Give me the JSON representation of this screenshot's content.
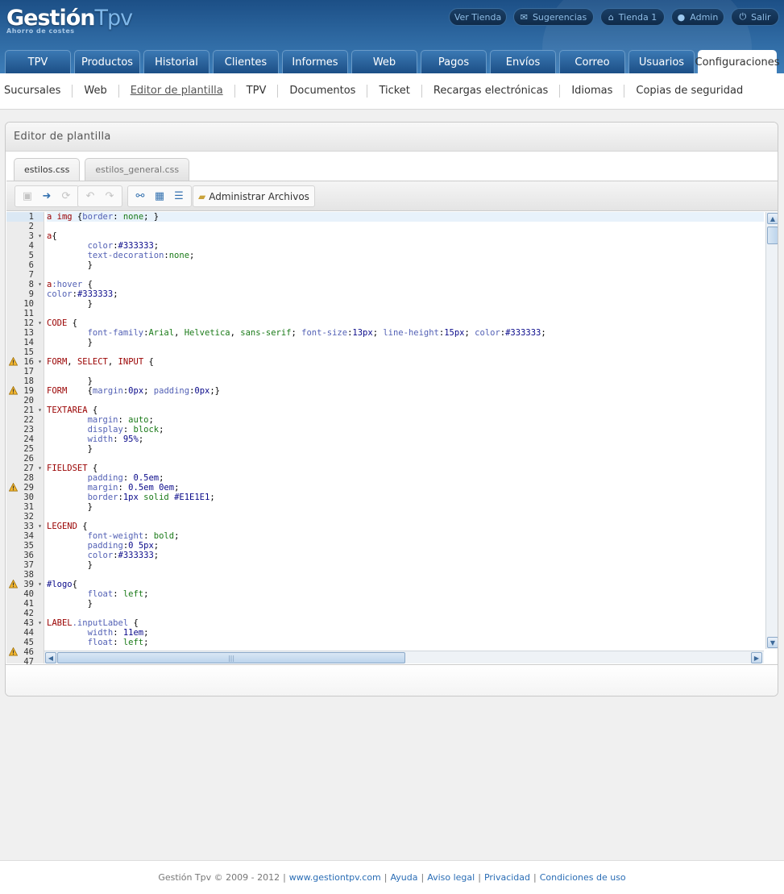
{
  "brand": {
    "name_a": "Gestión",
    "name_b": "Tpv",
    "tagline": "Ahorro de costes"
  },
  "top_links": [
    {
      "label": "Ver Tienda",
      "icon": "none"
    },
    {
      "label": "Sugerencias",
      "icon": "envelope-icon"
    },
    {
      "label": "Tienda 1",
      "icon": "home-icon"
    },
    {
      "label": "Admin",
      "icon": "user-icon"
    },
    {
      "label": "Salir",
      "icon": "power-icon"
    }
  ],
  "main_tabs": [
    "TPV",
    "Productos",
    "Historial",
    "Clientes",
    "Informes",
    "Web",
    "Pagos",
    "Envíos",
    "Correo",
    "Usuarios",
    "Configuraciones"
  ],
  "active_main_tab": "Configuraciones",
  "sub_nav": [
    "Sucursales",
    "Web",
    "Editor de plantilla",
    "TPV",
    "Documentos",
    "Ticket",
    "Recargas electrónicas",
    "Idiomas",
    "Copias de seguridad"
  ],
  "active_sub_nav": "Editor de plantilla",
  "panel": {
    "title": "Editor de plantilla"
  },
  "file_tabs": [
    {
      "label": "estilos.css",
      "active": true
    },
    {
      "label": "estilos_general.css",
      "active": false
    }
  ],
  "toolbar": {
    "manage_files_label": "Administrar Archivos"
  },
  "editor": {
    "highlighted_line": 1,
    "warning_lines": [
      16,
      19,
      29,
      39,
      46
    ],
    "fold_lines": [
      3,
      8,
      12,
      16,
      21,
      27,
      33,
      39,
      43
    ],
    "lines": [
      [
        [
          "cs",
          "a img"
        ],
        [
          "ct",
          " {"
        ],
        [
          "cp",
          "border"
        ],
        [
          "ct",
          ": "
        ],
        [
          "cv",
          "none"
        ],
        [
          "ct",
          "; }"
        ]
      ],
      [],
      [
        [
          "cs",
          "a"
        ],
        [
          "ct",
          "{"
        ]
      ],
      [
        [
          "ct",
          "        "
        ],
        [
          "cp",
          "color"
        ],
        [
          "ct",
          ":"
        ],
        [
          "ch",
          "#333333"
        ],
        [
          "ct",
          ";"
        ]
      ],
      [
        [
          "ct",
          "        "
        ],
        [
          "cp",
          "text-decoration"
        ],
        [
          "ct",
          ":"
        ],
        [
          "cv",
          "none"
        ],
        [
          "ct",
          ";"
        ]
      ],
      [
        [
          "ct",
          "        }"
        ]
      ],
      [],
      [
        [
          "cs",
          "a"
        ],
        [
          "cp",
          ":hover"
        ],
        [
          "ct",
          " {"
        ]
      ],
      [
        [
          "cp",
          "color"
        ],
        [
          "ct",
          ":"
        ],
        [
          "ch",
          "#333333"
        ],
        [
          "ct",
          ";"
        ]
      ],
      [
        [
          "ct",
          "        }"
        ]
      ],
      [],
      [
        [
          "cs",
          "CODE"
        ],
        [
          "ct",
          " {"
        ]
      ],
      [
        [
          "ct",
          "        "
        ],
        [
          "cp",
          "font-family"
        ],
        [
          "ct",
          ":"
        ],
        [
          "cv",
          "Arial"
        ],
        [
          "ct",
          ", "
        ],
        [
          "cv",
          "Helvetica"
        ],
        [
          "ct",
          ", "
        ],
        [
          "cv",
          "sans-serif"
        ],
        [
          "ct",
          "; "
        ],
        [
          "cp",
          "font-size"
        ],
        [
          "ct",
          ":"
        ],
        [
          "ch",
          "13px"
        ],
        [
          "ct",
          "; "
        ],
        [
          "cp",
          "line-height"
        ],
        [
          "ct",
          ":"
        ],
        [
          "ch",
          "15px"
        ],
        [
          "ct",
          "; "
        ],
        [
          "cp",
          "color"
        ],
        [
          "ct",
          ":"
        ],
        [
          "ch",
          "#333333"
        ],
        [
          "ct",
          ";"
        ]
      ],
      [
        [
          "ct",
          "        }"
        ]
      ],
      [],
      [
        [
          "cs",
          "FORM"
        ],
        [
          "ct",
          ", "
        ],
        [
          "cs",
          "SELECT"
        ],
        [
          "ct",
          ", "
        ],
        [
          "cs",
          "INPUT"
        ],
        [
          "ct",
          " {"
        ]
      ],
      [],
      [
        [
          "ct",
          "        }"
        ]
      ],
      [
        [
          "cs",
          "FORM"
        ],
        [
          "ct",
          "    {"
        ],
        [
          "cp",
          "margin"
        ],
        [
          "ct",
          ":"
        ],
        [
          "ch",
          "0px"
        ],
        [
          "ct",
          "; "
        ],
        [
          "cp",
          "padding"
        ],
        [
          "ct",
          ":"
        ],
        [
          "ch",
          "0px"
        ],
        [
          "ct",
          ";}"
        ]
      ],
      [],
      [
        [
          "cs",
          "TEXTAREA"
        ],
        [
          "ct",
          " {"
        ]
      ],
      [
        [
          "ct",
          "        "
        ],
        [
          "cp",
          "margin"
        ],
        [
          "ct",
          ": "
        ],
        [
          "cv",
          "auto"
        ],
        [
          "ct",
          ";"
        ]
      ],
      [
        [
          "ct",
          "        "
        ],
        [
          "cp",
          "display"
        ],
        [
          "ct",
          ": "
        ],
        [
          "cv",
          "block"
        ],
        [
          "ct",
          ";"
        ]
      ],
      [
        [
          "ct",
          "        "
        ],
        [
          "cp",
          "width"
        ],
        [
          "ct",
          ": "
        ],
        [
          "ch",
          "95%"
        ],
        [
          "ct",
          ";"
        ]
      ],
      [
        [
          "ct",
          "        }"
        ]
      ],
      [],
      [
        [
          "cs",
          "FIELDSET"
        ],
        [
          "ct",
          " {"
        ]
      ],
      [
        [
          "ct",
          "        "
        ],
        [
          "cp",
          "padding"
        ],
        [
          "ct",
          ": "
        ],
        [
          "ch",
          "0.5em"
        ],
        [
          "ct",
          ";"
        ]
      ],
      [
        [
          "ct",
          "        "
        ],
        [
          "cp",
          "margin"
        ],
        [
          "ct",
          ": "
        ],
        [
          "ch",
          "0.5em 0em"
        ],
        [
          "ct",
          ";"
        ]
      ],
      [
        [
          "ct",
          "        "
        ],
        [
          "cp",
          "border"
        ],
        [
          "ct",
          ":"
        ],
        [
          "ch",
          "1px"
        ],
        [
          "ct",
          " "
        ],
        [
          "cv",
          "solid"
        ],
        [
          "ct",
          " "
        ],
        [
          "ch",
          "#E1E1E1"
        ],
        [
          "ct",
          ";"
        ]
      ],
      [
        [
          "ct",
          "        }"
        ]
      ],
      [],
      [
        [
          "cs",
          "LEGEND"
        ],
        [
          "ct",
          " {"
        ]
      ],
      [
        [
          "ct",
          "        "
        ],
        [
          "cp",
          "font-weight"
        ],
        [
          "ct",
          ": "
        ],
        [
          "cv",
          "bold"
        ],
        [
          "ct",
          ";"
        ]
      ],
      [
        [
          "ct",
          "        "
        ],
        [
          "cp",
          "padding"
        ],
        [
          "ct",
          ":"
        ],
        [
          "ch",
          "0 5px"
        ],
        [
          "ct",
          ";"
        ]
      ],
      [
        [
          "ct",
          "        "
        ],
        [
          "cp",
          "color"
        ],
        [
          "ct",
          ":"
        ],
        [
          "ch",
          "#333333"
        ],
        [
          "ct",
          ";"
        ]
      ],
      [
        [
          "ct",
          "        }"
        ]
      ],
      [],
      [
        [
          "ch",
          "#logo"
        ],
        [
          "ct",
          "{"
        ]
      ],
      [
        [
          "ct",
          "        "
        ],
        [
          "cp",
          "float"
        ],
        [
          "ct",
          ": "
        ],
        [
          "cv",
          "left"
        ],
        [
          "ct",
          ";"
        ]
      ],
      [
        [
          "ct",
          "        }"
        ]
      ],
      [],
      [
        [
          "cs",
          "LABEL"
        ],
        [
          "cp",
          ".inputLabel"
        ],
        [
          "ct",
          " {"
        ]
      ],
      [
        [
          "ct",
          "        "
        ],
        [
          "cp",
          "width"
        ],
        [
          "ct",
          ": "
        ],
        [
          "ch",
          "11em"
        ],
        [
          "ct",
          ";"
        ]
      ],
      [
        [
          "ct",
          "        "
        ],
        [
          "cp",
          "float"
        ],
        [
          "ct",
          ": "
        ],
        [
          "cv",
          "left"
        ],
        [
          "ct",
          ";"
        ]
      ],
      [],
      []
    ]
  },
  "footer": {
    "copyright": "Gestión Tpv © 2009 - 2012",
    "links": [
      "www.gestiontpv.com",
      "Ayuda",
      "Aviso legal",
      "Privacidad",
      "Condiciones de uso"
    ]
  }
}
